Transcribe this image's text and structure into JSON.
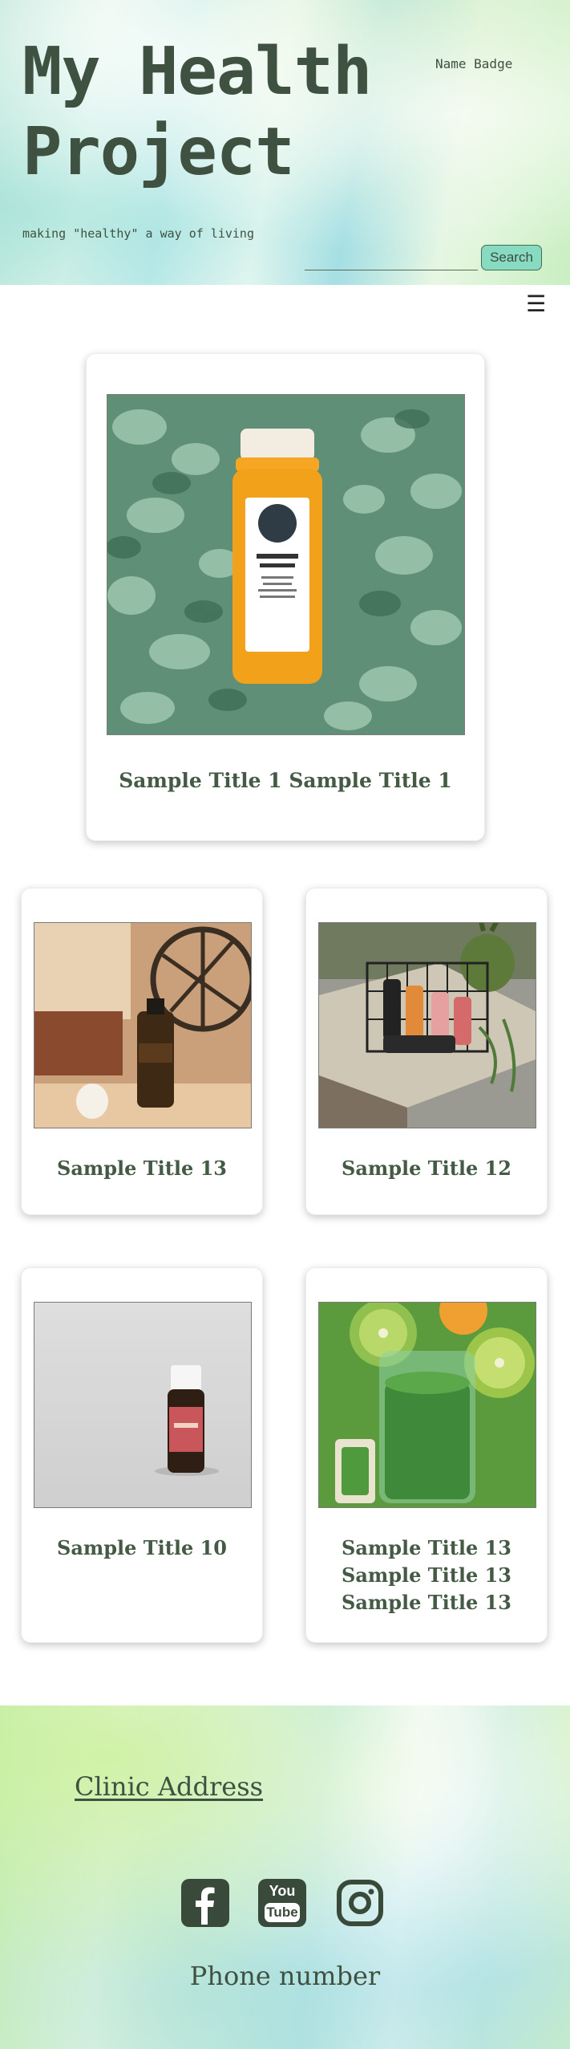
{
  "header": {
    "title": "My Health Project",
    "name_badge": "Name Badge",
    "tagline": "making \"healthy\" a way of living",
    "search": {
      "value": "",
      "button_label": "Search"
    },
    "menu_icon": "hamburger-menu-icon",
    "menu_glyph": "☰"
  },
  "cards": [
    {
      "title": "Sample Title 1 Sample Title 1",
      "image": "juice-bottle-on-eucalyptus-leaves"
    },
    {
      "title": "Sample Title 13",
      "image": "amber-dropper-bottle-with-lantern"
    },
    {
      "title": "Sample Title 12",
      "image": "bottles-in-wire-basket-on-wooden-crate"
    },
    {
      "title": "Sample Title 10",
      "image": "essential-oil-bottle-patchouli"
    },
    {
      "title": "Sample Title 13 Sample Title 13 Sample Title 13",
      "image": "green-smoothie-with-kiwi"
    }
  ],
  "footer": {
    "clinic_address": "Clinic Address",
    "social": [
      {
        "icon": "facebook-icon"
      },
      {
        "icon": "youtube-icon",
        "text_top": "You",
        "text_bottom": "Tube"
      },
      {
        "icon": "instagram-icon"
      }
    ],
    "phone_number": "Phone number"
  },
  "colors": {
    "text": "#3f5140",
    "card_title": "#445a44",
    "search_button": "#88dbc0",
    "social_icon": "#3a4a3a"
  }
}
